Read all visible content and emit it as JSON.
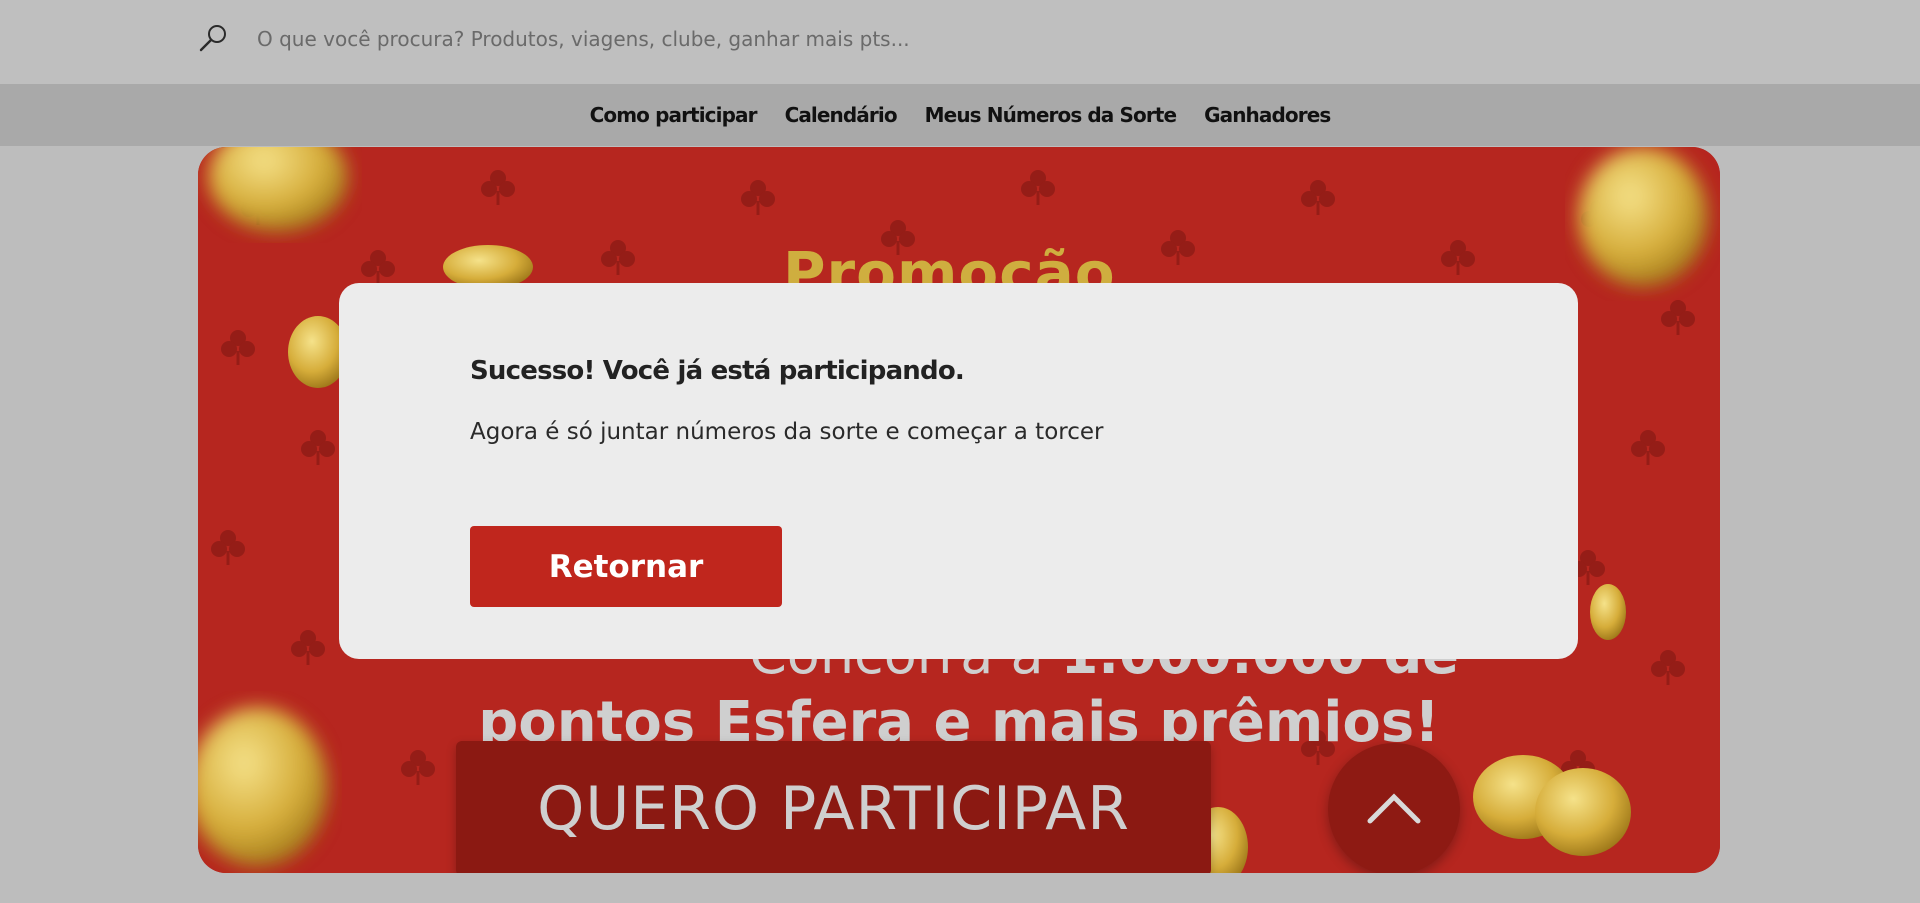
{
  "search": {
    "placeholder": "O que você procura? Produtos, viagens, clube, ganhar mais pts..."
  },
  "nav": {
    "items": [
      {
        "label": "Como participar"
      },
      {
        "label": "Calendário"
      },
      {
        "label": "Meus Números da Sorte"
      },
      {
        "label": "Ganhadores"
      }
    ]
  },
  "hero": {
    "title": "Promoção",
    "subtitle_line1_prefix": "Concorra a ",
    "subtitle_line1_bold": "1.000.000 de",
    "subtitle_line2": "pontos Esfera e mais prêmios!",
    "cta_label": "QUERO PARTICIPAR"
  },
  "modal": {
    "title": "Sucesso! Você já está participando.",
    "message": "Agora é só juntar números da sorte e começar a torcer",
    "button_label": "Retornar"
  },
  "icons": {
    "search": "search-icon",
    "scroll_top": "chevron-up-icon",
    "clover": "clover-icon",
    "coin": "coin-icon"
  },
  "colors": {
    "brand_red": "#c0261d",
    "dark_red": "#8b1912",
    "gold": "#cfae3f"
  }
}
